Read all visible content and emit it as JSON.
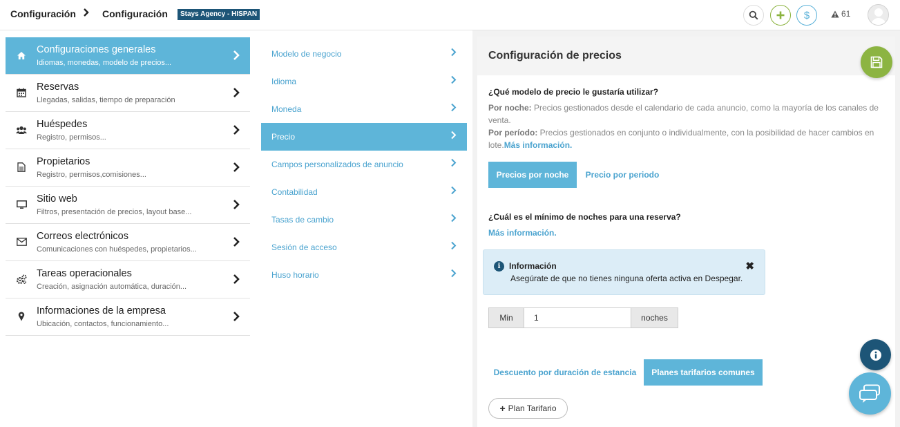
{
  "header": {
    "breadcrumb_root": "Configuración",
    "breadcrumb_current": "Configuración",
    "agency_badge": "Stays Agency - HISPAN",
    "alert_count": "61"
  },
  "sidebar": {
    "items": [
      {
        "title": "Configuraciones generales",
        "subtitle": "Idiomas, monedas, modelo de precios...",
        "icon": "home-icon",
        "active": true
      },
      {
        "title": "Reservas",
        "subtitle": "Llegadas, salidas, tiempo de preparación",
        "icon": "calendar-icon",
        "active": false
      },
      {
        "title": "Huéspedes",
        "subtitle": "Registro, permisos...",
        "icon": "users-icon",
        "active": false
      },
      {
        "title": "Propietarios",
        "subtitle": "Registro, permisos,comisiones...",
        "icon": "document-icon",
        "active": false
      },
      {
        "title": "Sitio web",
        "subtitle": "Filtros, presentación de precios, layout base...",
        "icon": "monitor-icon",
        "active": false
      },
      {
        "title": "Correos electrónicos",
        "subtitle": "Comunicaciones con huéspedes, propietarios...",
        "icon": "envelope-icon",
        "active": false
      },
      {
        "title": "Tareas operacionales",
        "subtitle": "Creación, asignación automática, duración...",
        "icon": "gears-icon",
        "active": false
      },
      {
        "title": "Informaciones de la empresa",
        "subtitle": "Ubicación, contactos, funcionamiento...",
        "icon": "map-pin-icon",
        "active": false
      }
    ]
  },
  "submenu": {
    "items": [
      {
        "label": "Modelo de negocio",
        "active": false
      },
      {
        "label": "Idioma",
        "active": false
      },
      {
        "label": "Moneda",
        "active": false
      },
      {
        "label": "Precio",
        "active": true
      },
      {
        "label": "Campos personalizados de anuncio",
        "active": false
      },
      {
        "label": "Contabilidad",
        "active": false
      },
      {
        "label": "Tasas de cambio",
        "active": false
      },
      {
        "label": "Sesión de acceso",
        "active": false
      },
      {
        "label": "Huso horario",
        "active": false
      }
    ]
  },
  "panel": {
    "title": "Configuración de precios",
    "question_model": "¿Qué modelo de precio le gustaría utilizar?",
    "per_night_label": "Por noche:",
    "per_night_text": " Precios gestionados desde el calendario de cada anuncio, como la mayoría de los canales de venta.",
    "per_period_label": "Por período:",
    "per_period_text": " Precios gestionados en conjunto o individualmente, con la posibilidad de hacer cambios en lote.",
    "more_info_inline": "Más información.",
    "tab_per_night": "Precios por noche",
    "tab_per_period": "Precio por periodo",
    "question_min_nights": "¿Cuál es el mínimo de noches para una reserva?",
    "more_info": "Más información.",
    "info_box": {
      "title": "Información",
      "text": "Asegúrate de que no tienes ninguna oferta activa en Despegar."
    },
    "min_nights": {
      "prefix": "Min",
      "value": "1",
      "suffix": "noches"
    },
    "tab_discount": "Descuento por duración de estancia",
    "tab_rate_plans": "Planes tarifarios comunes",
    "add_plan_label": "Plan Tarifario"
  },
  "colors": {
    "accent": "#5eb5d9",
    "link": "#4aa3cf",
    "dark_blue": "#1d5577",
    "green": "#8cb442"
  }
}
